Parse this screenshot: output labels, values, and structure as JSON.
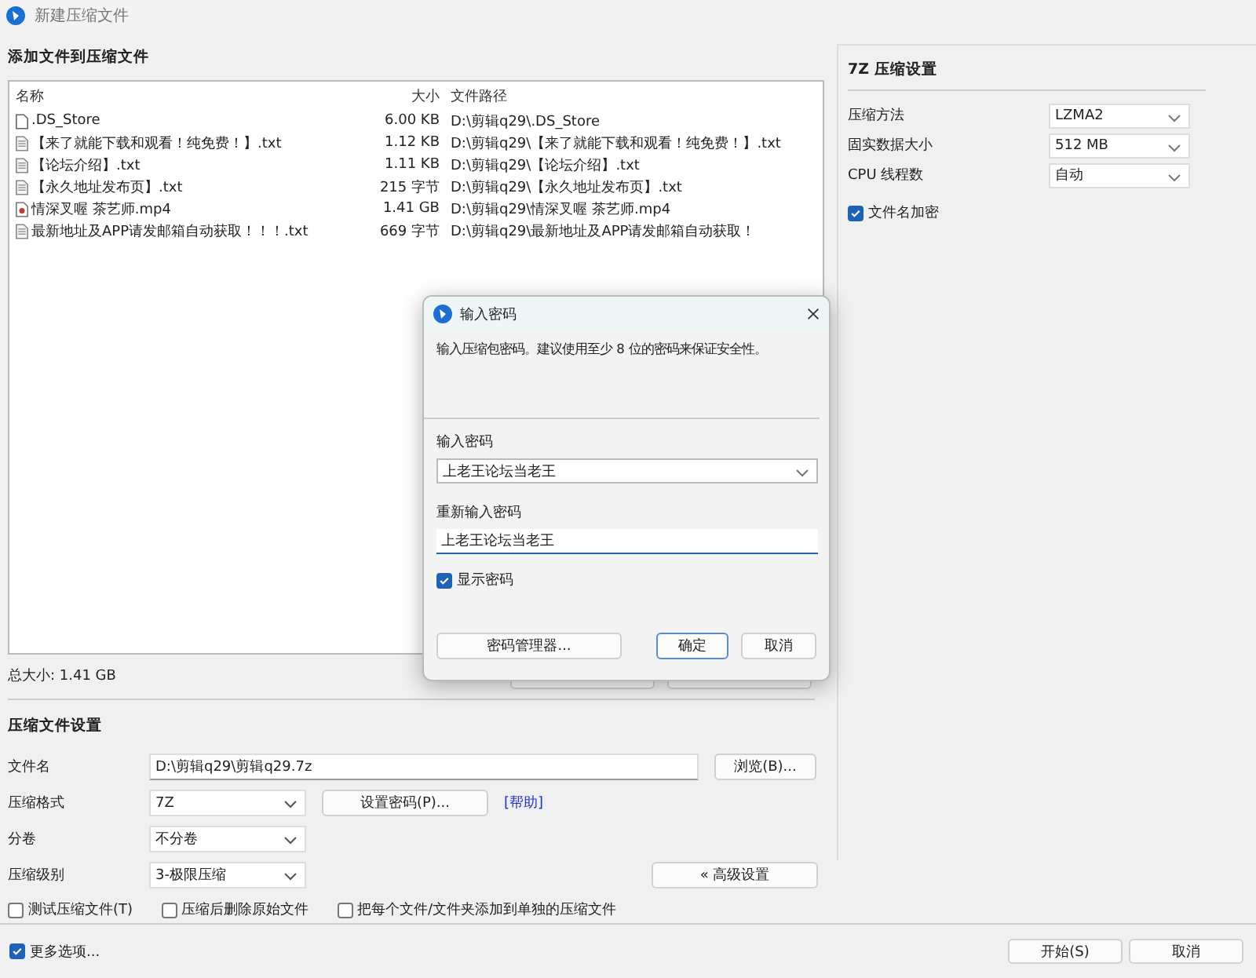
{
  "window": {
    "title": "新建压缩文件"
  },
  "files": {
    "heading": "添加文件到压缩文件",
    "columns": [
      "名称",
      "大小",
      "文件路径"
    ],
    "rows": [
      {
        "kind": "blank",
        "name": ".DS_Store",
        "size": "6.00 KB",
        "path": "D:\\剪辑q29\\.DS_Store"
      },
      {
        "kind": "text",
        "name": "【来了就能下载和观看！纯免费！】.txt",
        "size": "1.12 KB",
        "path": "D:\\剪辑q29\\【来了就能下载和观看！纯免费！】.txt"
      },
      {
        "kind": "text",
        "name": "【论坛介绍】.txt",
        "size": "1.11 KB",
        "path": "D:\\剪辑q29\\【论坛介绍】.txt"
      },
      {
        "kind": "text",
        "name": "【永久地址发布页】.txt",
        "size": "215 字节",
        "path": "D:\\剪辑q29\\【永久地址发布页】.txt"
      },
      {
        "kind": "video",
        "name": "情深叉喔 茶艺师.mp4",
        "size": "1.41 GB",
        "path": "D:\\剪辑q29\\情深叉喔 茶艺师.mp4"
      },
      {
        "kind": "text",
        "name": "最新地址及APP请发邮箱自动获取！！！.txt",
        "size": "669 字节",
        "path": "D:\\剪辑q29\\最新地址及APP请发邮箱自动获取！"
      }
    ],
    "total": "总大小: 1.41 GB"
  },
  "settings": {
    "heading": "压缩文件设置",
    "filename": {
      "label": "文件名",
      "value": "D:\\剪辑q29\\剪辑q29.7z",
      "browse": "浏览(B)..."
    },
    "format": {
      "label": "压缩格式",
      "value": "7Z",
      "password_button": "设置密码(P)...",
      "help": "[帮助]"
    },
    "split": {
      "label": "分卷",
      "value": "不分卷"
    },
    "level": {
      "label": "压缩级别",
      "value": "3-极限压缩",
      "advanced": "« 高级设置"
    },
    "options": [
      {
        "label": "测试压缩文件(T)",
        "checked": false
      },
      {
        "label": "压缩后删除原始文件",
        "checked": false
      },
      {
        "label": "把每个文件/文件夹添加到单独的压缩文件",
        "checked": false
      }
    ]
  },
  "footer": {
    "more": {
      "label": "更多选项...",
      "checked": true
    },
    "buttons": [
      "开始(S)",
      "取消"
    ]
  },
  "advanced": {
    "heading": "7Z 压缩设置",
    "rows": [
      {
        "label": "压缩方法",
        "value": "LZMA2"
      },
      {
        "label": "固实数据大小",
        "value": "512 MB"
      },
      {
        "label": "CPU 线程数",
        "value": "自动"
      }
    ],
    "encrypt_names": {
      "label": "文件名加密",
      "checked": true
    }
  },
  "dialog": {
    "title": "输入密码",
    "message": "输入压缩包密码。建议使用至少 8 位的密码来保证安全性。",
    "password_label": "输入密码",
    "password": "上老王论坛当老王",
    "repeat_label": "重新输入密码",
    "repeat": "上老王论坛当老王",
    "show": {
      "label": "显示密码",
      "checked": true
    },
    "buttons": [
      "密码管理器...",
      "确定",
      "取消"
    ]
  }
}
